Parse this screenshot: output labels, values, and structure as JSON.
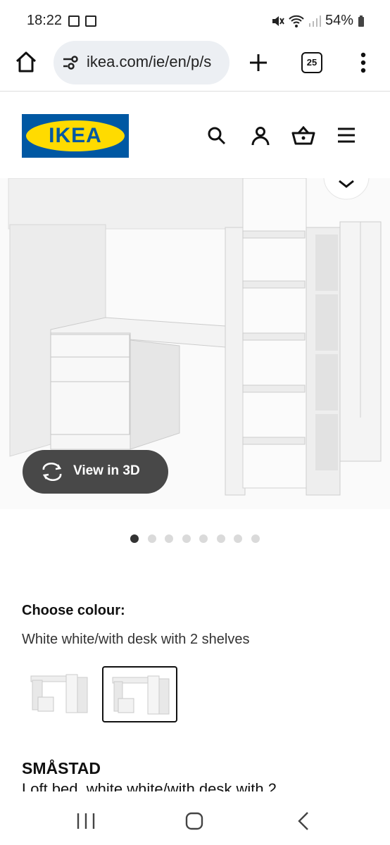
{
  "status": {
    "time": "18:22",
    "battery": "54%"
  },
  "browser": {
    "url": "ikea.com/ie/en/p/s",
    "tab_count": "25"
  },
  "brand": {
    "logo_text": "IKEA",
    "blue": "#0058a3",
    "yellow": "#ffdb00"
  },
  "header_icons": [
    "search-icon",
    "account-icon",
    "basket-icon",
    "menu-icon"
  ],
  "gallery": {
    "view3d_label": "View in 3D",
    "dot_count": 8,
    "active_index": 0
  },
  "product": {
    "choose_colour_label": "Choose colour:",
    "selected_variant": "White white/with desk with 2 shelves",
    "name": "SMÅSTAD",
    "description": "Loft bed, white white/with desk with 2"
  }
}
